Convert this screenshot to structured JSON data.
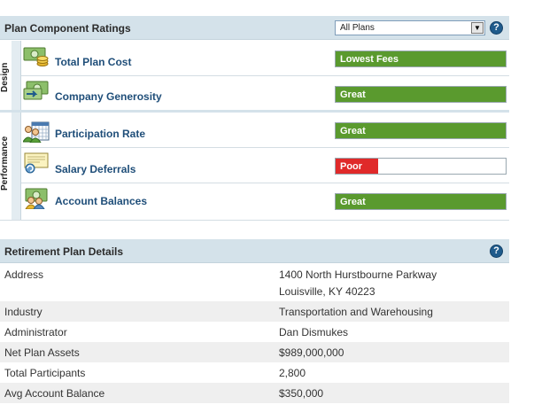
{
  "ratings": {
    "title": "Plan Component Ratings",
    "plan_selector": {
      "selected": "All Plans"
    },
    "help_label": "?",
    "groups": {
      "design": "Design",
      "performance": "Performance"
    },
    "items": [
      {
        "label": "Total Plan Cost",
        "rating": "Lowest Fees",
        "icon": "money-coins-icon",
        "level": 1.0,
        "color": "#5a9a2e"
      },
      {
        "label": "Company Generosity",
        "rating": "Great",
        "icon": "money-transfer-icon",
        "level": 1.0,
        "color": "#5a9a2e"
      },
      {
        "label": "Participation Rate",
        "rating": "Great",
        "icon": "people-calendar-icon",
        "level": 1.0,
        "color": "#5a9a2e"
      },
      {
        "label": "Salary Deferrals",
        "rating": "Poor",
        "icon": "paycheck-icon",
        "level": 0.25,
        "color": "#e02a2a"
      },
      {
        "label": "Account Balances",
        "rating": "Great",
        "icon": "people-money-icon",
        "level": 1.0,
        "color": "#5a9a2e"
      }
    ]
  },
  "details": {
    "title": "Retirement Plan Details",
    "help_label": "?",
    "rows": [
      {
        "label": "Address",
        "value": "1400 North Hurstbourne Parkway"
      },
      {
        "label": "",
        "value": "Louisville, KY 40223"
      },
      {
        "label": "Industry",
        "value": "Transportation and Warehousing"
      },
      {
        "label": "Administrator",
        "value": "Dan Dismukes"
      },
      {
        "label": "Net Plan Assets",
        "value": "$989,000,000"
      },
      {
        "label": "Total Participants",
        "value": "2,800"
      },
      {
        "label": "Avg Account Balance",
        "value": "$350,000"
      }
    ]
  }
}
